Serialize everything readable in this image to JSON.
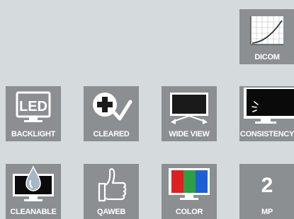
{
  "features": {
    "dicom": {
      "label": "DICOM",
      "icon": "dicom-curve-icon"
    },
    "backlight": {
      "label": "BACKLIGHT",
      "icon": "led-monitor-icon"
    },
    "cleared": {
      "label": "CLEARED",
      "icon": "medical-cross-check-icon"
    },
    "wideview": {
      "label": "WIDE VIEW",
      "icon": "wide-view-monitor-icon"
    },
    "consistency": {
      "label": "CONSISTENCY",
      "icon": "monitor-sensor-icon"
    },
    "cleanable": {
      "label": "CLEANABLE",
      "icon": "water-drop-monitor-icon"
    },
    "qaweb": {
      "label": "QAWEB",
      "icon": "thumbs-up-icon"
    },
    "color": {
      "label": "COLOR",
      "icon": "color-monitor-icon",
      "colors": [
        "#e02020",
        "#2ea043",
        "#1f5fd6"
      ]
    },
    "mp": {
      "label": "MP",
      "value": "2",
      "icon": "megapixel-icon"
    }
  }
}
